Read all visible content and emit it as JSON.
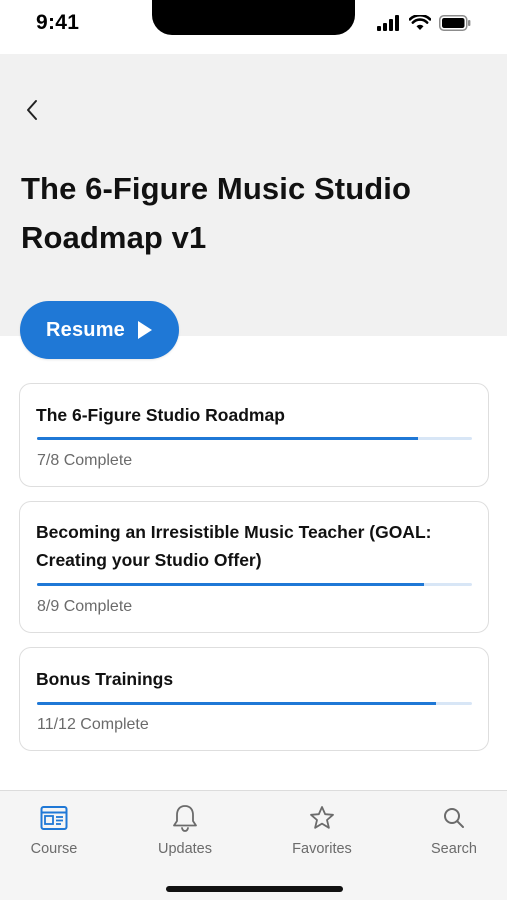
{
  "status_bar": {
    "time": "9:41"
  },
  "page": {
    "title": "The 6-Figure Music Studio Roadmap v1",
    "resume_label": "Resume"
  },
  "modules": [
    {
      "title": "The 6-Figure Studio Roadmap",
      "status": "7/8 Complete",
      "progress": 0.875
    },
    {
      "title": "Becoming an Irresistible Music Teacher (GOAL: Creating your Studio Offer)",
      "status": "8/9 Complete",
      "progress": 0.889
    },
    {
      "title": "Bonus Trainings",
      "status": "11/12 Complete",
      "progress": 0.917
    }
  ],
  "tabs": [
    {
      "label": "Course",
      "icon": "course-icon",
      "active": true
    },
    {
      "label": "Updates",
      "icon": "bell-icon",
      "active": false
    },
    {
      "label": "Favorites",
      "icon": "star-icon",
      "active": false
    },
    {
      "label": "Search",
      "icon": "search-icon",
      "active": false
    }
  ],
  "colors": {
    "accent": "#1f78d6",
    "header_bg": "#f1f1f1",
    "tab_bar_bg": "#f5f5f5",
    "muted_text": "#6b6b6b"
  }
}
